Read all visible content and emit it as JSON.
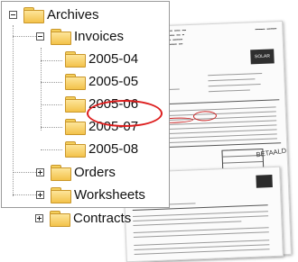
{
  "tree": {
    "root": {
      "label": "Archives",
      "expanded": true
    },
    "children": [
      {
        "label": "Invoices",
        "expanded": true,
        "children": [
          {
            "label": "2005-04"
          },
          {
            "label": "2005-05"
          },
          {
            "label": "2005-06",
            "highlighted": true
          },
          {
            "label": "2005-07"
          },
          {
            "label": "2005-08"
          }
        ]
      },
      {
        "label": "Orders",
        "expanded": false
      },
      {
        "label": "Worksheets",
        "expanded": false
      },
      {
        "label": "Contracts",
        "expanded": false
      }
    ]
  },
  "highlight_color": "#dd1e1e",
  "folder_color": "#f3c24a",
  "documents": {
    "back": {
      "stamp": "BETAALD",
      "logo": "SOLAR"
    },
    "front": {}
  }
}
